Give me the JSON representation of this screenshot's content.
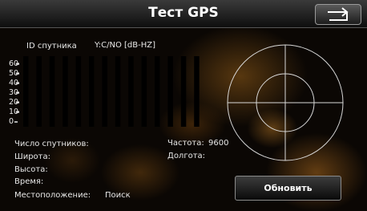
{
  "title": "Тест GPS",
  "header": {
    "sat_id_label": "ID спутника",
    "snr_label": "Y:C/NO [dB-HZ]"
  },
  "y_ticks": [
    "60",
    "50",
    "40",
    "30",
    "20",
    "10",
    "0"
  ],
  "info": {
    "sat_count": "Число спутников:",
    "latitude": "Широта:",
    "altitude": "Высота:",
    "time": "Время:",
    "frequency_label": "Частота:",
    "frequency_value": "9600",
    "longitude": "Долгота:",
    "location_label": "Местоположение:",
    "location_value": "Поиск"
  },
  "refresh_label": "Обновить",
  "chart_data": {
    "type": "bar",
    "ylabel": "Y:C/NO [dB-HZ]",
    "ylim": [
      0,
      60
    ],
    "categories": [
      "",
      "",
      "",
      "",
      "",
      "",
      "",
      "",
      "",
      "",
      "",
      "",
      "",
      ""
    ],
    "values": [
      0,
      0,
      0,
      0,
      0,
      0,
      0,
      0,
      0,
      0,
      0,
      0,
      0,
      0
    ]
  },
  "colors": {
    "bar_track": "#000000",
    "grid_line": "#d8d8d8",
    "text": "#e8e8e8"
  }
}
